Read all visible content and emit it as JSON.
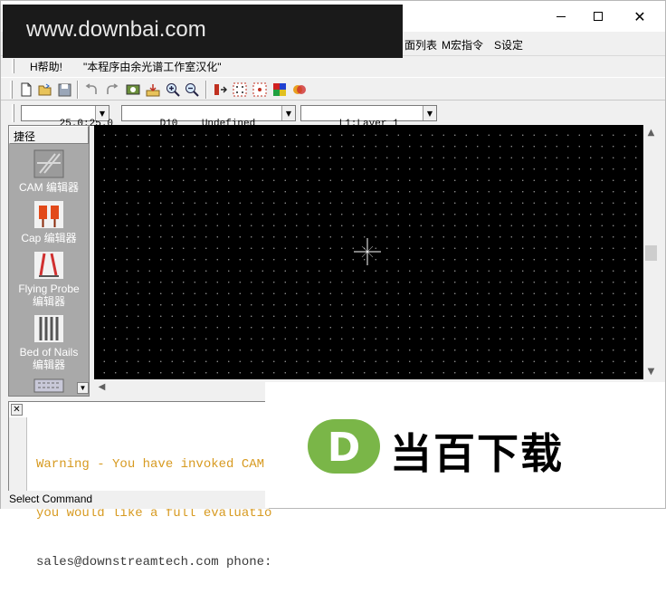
{
  "watermark": {
    "text": "www.downbai.com"
  },
  "window_controls": {
    "minimize": "—",
    "maximize": "☐",
    "close": "✕"
  },
  "menu": {
    "items_visible": [
      "面列表",
      "M宏指令",
      "S设定"
    ]
  },
  "infobar": {
    "help": "H帮助!",
    "note": "\"本程序由余光谱工作室汉化\""
  },
  "toolbar": {
    "icons": [
      "new-file-icon",
      "open-folder-icon",
      "save-icon",
      "undo-icon",
      "redo-icon",
      "refresh-icon",
      "import-icon",
      "zoom-in-icon",
      "zoom-out-icon",
      "origin-icon",
      "grid-icon",
      "snap-grid-icon",
      "color-icon",
      "layers-icon"
    ]
  },
  "combos": {
    "grid": "25.0:25.0",
    "aperture": "D10    Undefined",
    "layer": "L1:Layer_1"
  },
  "shortcuts": {
    "header": "捷径",
    "items": [
      {
        "label": "CAM 编辑器",
        "icon": "cam-editor-icon"
      },
      {
        "label": "Cap 编辑器",
        "icon": "cap-editor-icon"
      },
      {
        "label": "Flying Probe\n编辑器",
        "icon": "flying-probe-icon"
      },
      {
        "label": "Bed of Nails\n编辑器",
        "icon": "bed-of-nails-icon"
      }
    ]
  },
  "command": {
    "lines": [
      "Warning - You have invoked CAM35",
      "you would like a full evaluatio",
      "sales@downstreamtech.com phone:"
    ]
  },
  "status": {
    "text": "Select Command"
  },
  "logo": {
    "text": "当百下载",
    "letter": "D",
    "accent": "#7ab648"
  },
  "colors": {
    "canvas": "#000000",
    "warning": "#d79a20",
    "panel": "#a9a9a9"
  }
}
